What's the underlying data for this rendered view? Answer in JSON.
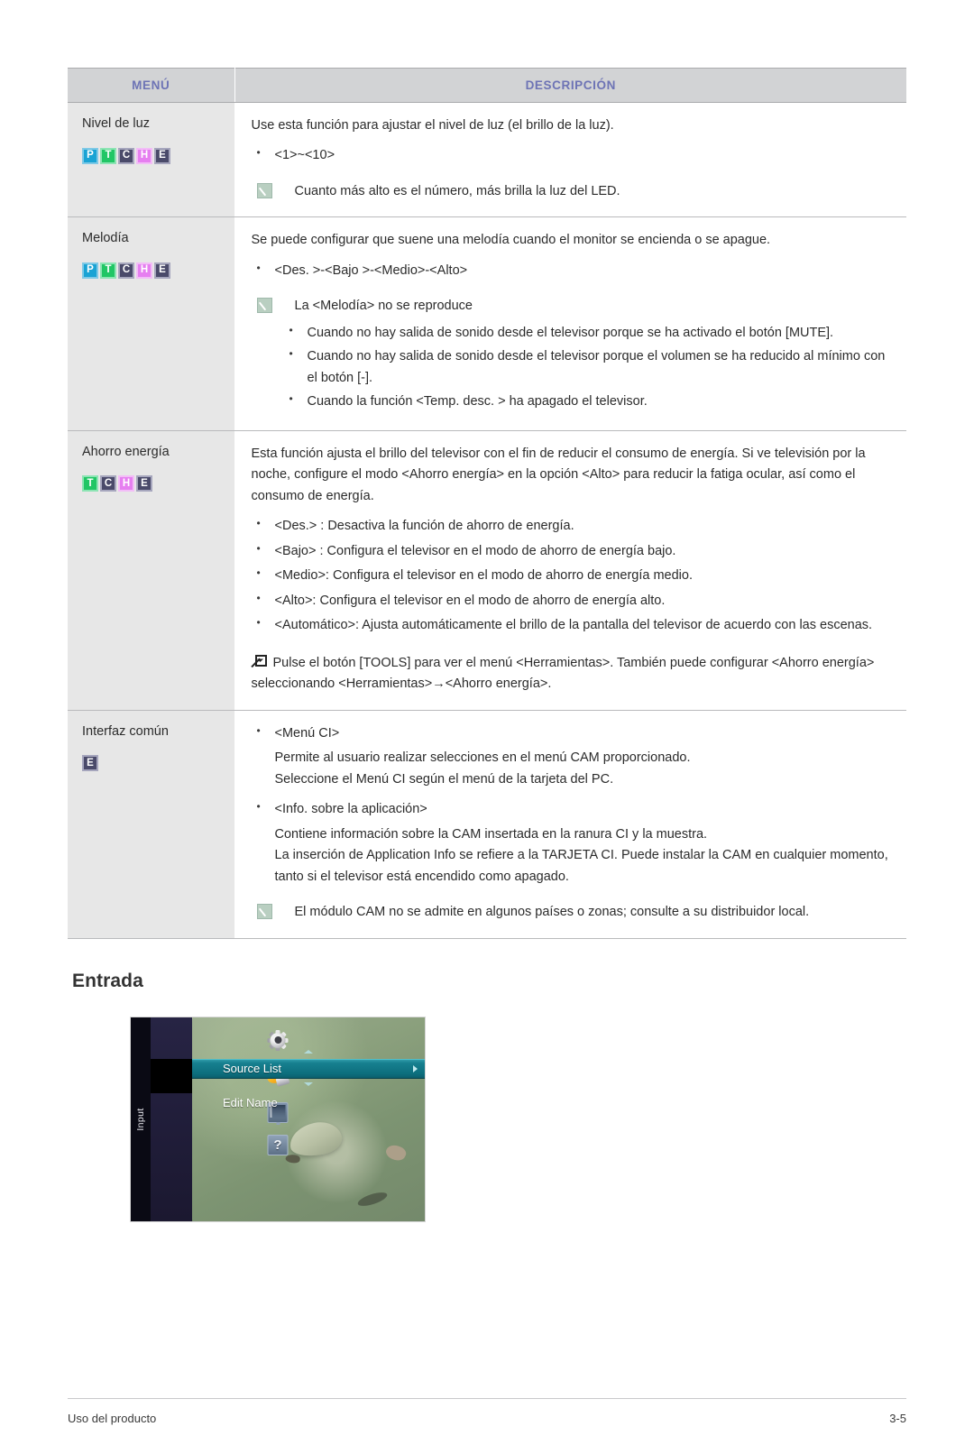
{
  "table": {
    "headers": {
      "menu": "MENÚ",
      "description": "DESCRIPCIÓN"
    },
    "rows": [
      {
        "menu": "Nivel de luz",
        "badges": [
          "P",
          "T",
          "C",
          "H",
          "E"
        ],
        "intro": "Use esta función para ajustar el nivel de luz (el brillo de la luz).",
        "bullets": [
          "<1>~<10>"
        ],
        "note": "Cuanto más alto es el número, más brilla la luz del LED."
      },
      {
        "menu": "Melodía",
        "badges": [
          "P",
          "T",
          "C",
          "H",
          "E"
        ],
        "intro": "Se puede configurar que suene una melodía cuando el monitor se encienda o se apague.",
        "bullets": [
          "<Des. >-<Bajo >-<Medio>-<Alto>"
        ],
        "note": "La <Melodía> no se reproduce",
        "subbullets": [
          "Cuando no hay salida de sonido desde el televisor porque se ha activado el botón [MUTE].",
          "Cuando no hay salida de sonido desde el televisor porque el volumen se ha reducido al mínimo con el botón [-].",
          "Cuando la función <Temp. desc. > ha apagado el televisor."
        ]
      },
      {
        "menu": "Ahorro energía",
        "badges": [
          "T",
          "C",
          "H",
          "E"
        ],
        "intro": "Esta función ajusta el brillo del televisor con el fin de reducir el consumo de energía. Si ve televisión por la noche, configure el modo <Ahorro energía> en la opción <Alto> para reducir la fatiga ocular, así como el consumo de energía.",
        "bullets": [
          "<Des.> : Desactiva la función de ahorro de energía.",
          "<Bajo> : Configura el televisor en el modo de ahorro de energía bajo.",
          "<Medio>: Configura el televisor en el modo de ahorro de energía medio.",
          "<Alto>: Configura el televisor en el modo de ahorro de energía alto.",
          "<Automático>: Ajusta automáticamente el brillo de la pantalla del televisor de acuerdo con las escenas."
        ],
        "tools": "Pulse el botón [TOOLS] para ver el menú <Herramientas>. También puede configurar <Ahorro energía> seleccionando <Herramientas>→<Ahorro energía>."
      },
      {
        "menu": "Interfaz común",
        "badges": [
          "E"
        ],
        "groups": [
          {
            "bullet": "<Menú CI>",
            "lines": [
              "Permite al usuario realizar selecciones en el menú CAM proporcionado.",
              "Seleccione el Menú CI según el menú de la tarjeta del PC."
            ]
          },
          {
            "bullet": "<Info. sobre la aplicación>",
            "lines": [
              "Contiene información sobre la CAM insertada en la ranura CI y la muestra.",
              "La inserción de Application Info se refiere a la TARJETA CI. Puede instalar la CAM en cualquier momento, tanto si el televisor está encendido como apagado."
            ]
          }
        ],
        "note": "El módulo CAM no se admite en algunos países o zonas; consulte a su distribuidor local."
      }
    ]
  },
  "section": {
    "title": "Entrada"
  },
  "osd": {
    "side_label": "Input",
    "icons": [
      "gear-icon",
      "input-plug-icon",
      "screen-icon",
      "help-icon"
    ],
    "items": [
      {
        "label": "Source List",
        "selected": true
      },
      {
        "label": "Edit Name",
        "selected": false
      }
    ],
    "help_glyph": "?"
  },
  "footer": {
    "left": "Uso del producto",
    "page": "3-5"
  },
  "colors": {
    "header_bg": "#d2d3d5",
    "header_text": "#6d73b5",
    "menu_cell_bg": "#e7e7e7",
    "badge_p": "#1aa3d4",
    "badge_t": "#21c665",
    "badge_c": "#4a4a6a",
    "badge_h": "#e67ff0",
    "badge_e": "#4a4a6a",
    "osd_highlight": "#0d6f7e"
  }
}
